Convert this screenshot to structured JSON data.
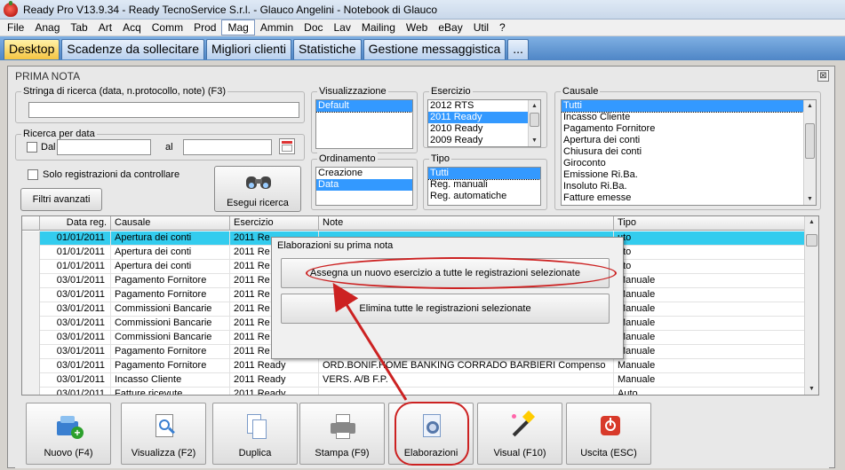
{
  "window": {
    "title": "Ready Pro V13.9.34 - Ready TecnoService S.r.l. - Glauco Angelini - Notebook di Glauco"
  },
  "menu": [
    "File",
    "Anag",
    "Tab",
    "Art",
    "Acq",
    "Comm",
    "Prod",
    "Mag",
    "Ammin",
    "Doc",
    "Lav",
    "Mailing",
    "Web",
    "eBay",
    "Util",
    "?"
  ],
  "menu_active": "Mag",
  "tabs": [
    "Desktop",
    "Scadenze da sollecitare",
    "Migliori clienti",
    "Statistiche",
    "Gestione messaggistica",
    "..."
  ],
  "panel": {
    "title": "PRIMA NOTA",
    "close": "⊠",
    "search_label": "Stringa di ricerca (data, n.protocollo, note) (F3)",
    "search_value": "",
    "date_group": "Ricerca per data",
    "dal_label": "Dal",
    "al_label": "al",
    "solo_label": "Solo registrazioni da controllare",
    "filtri_button": "Filtri avanzati",
    "esegui_button": "Esegui ricerca",
    "visualizzazione_label": "Visualizzazione",
    "visualizzazione_options": [
      "Default"
    ],
    "ordinamento_label": "Ordinamento",
    "ordinamento_options": [
      "Creazione",
      "Data"
    ],
    "esercizio_label": "Esercizio",
    "esercizio_options": [
      "2012 RTS",
      "2011 Ready",
      "2010 Ready",
      "2009 Ready"
    ],
    "tipo_label": "Tipo",
    "tipo_options": [
      "Tutti",
      "Reg. manuali",
      "Reg. automatiche"
    ],
    "causale_label": "Causale",
    "causale_options": [
      "Tutti",
      "Incasso Cliente",
      "Pagamento Fornitore",
      "Apertura dei conti",
      "Chiusura dei conti",
      "Giroconto",
      "Emissione Ri.Ba.",
      "Insoluto Ri.Ba.",
      "Fatture emesse"
    ]
  },
  "grid": {
    "headers": [
      "Data reg.",
      "Causale",
      "Esercizio",
      "Note",
      "Tipo"
    ],
    "rows": [
      [
        "01/01/2011",
        "Apertura dei conti",
        "2011 Re",
        "",
        "uto"
      ],
      [
        "01/01/2011",
        "Apertura dei conti",
        "2011 Re",
        "",
        "uto"
      ],
      [
        "01/01/2011",
        "Apertura dei conti",
        "2011 Re",
        "",
        "uto"
      ],
      [
        "03/01/2011",
        "Pagamento Fornitore",
        "2011 Re",
        "",
        "Manuale"
      ],
      [
        "03/01/2011",
        "Pagamento Fornitore",
        "2011 Re",
        "",
        "Manuale"
      ],
      [
        "03/01/2011",
        "Commissioni Bancarie",
        "2011 Re",
        "",
        "Manuale"
      ],
      [
        "03/01/2011",
        "Commissioni Bancarie",
        "2011 Re",
        "",
        "Manuale"
      ],
      [
        "03/01/2011",
        "Commissioni Bancarie",
        "2011 Re",
        "",
        "Manuale"
      ],
      [
        "03/01/2011",
        "Pagamento Fornitore",
        "2011 Re",
        "",
        "Manuale"
      ],
      [
        "03/01/2011",
        "Pagamento Fornitore",
        "2011 Ready",
        "ORD.BONIF.HOME BANKING CORRADO BARBIERI Compenso",
        "Manuale"
      ],
      [
        "03/01/2011",
        "Incasso Cliente",
        "2011 Ready",
        "VERS. A/B F.P.",
        "Manuale"
      ],
      [
        "03/01/2011",
        "Fatture ricevute",
        "2011 Ready",
        "",
        "Auto"
      ]
    ]
  },
  "popup": {
    "title": "Elaborazioni su prima nota",
    "btn1": "Assegna un nuovo esercizio a tutte le registrazioni selezionate",
    "btn2": "Elimina tutte le registrazioni selezionate"
  },
  "toolbar": {
    "nuovo": "Nuovo (F4)",
    "visualizza": "Visualizza (F2)",
    "duplica": "Duplica",
    "stampa": "Stampa (F9)",
    "elaborazioni": "Elaborazioni",
    "visual": "Visual (F10)",
    "uscita": "Uscita (ESC)"
  },
  "icons": {
    "app": "strawberry-icon",
    "calendar": "calendar-icon",
    "binoculars": "binoculars-icon"
  }
}
